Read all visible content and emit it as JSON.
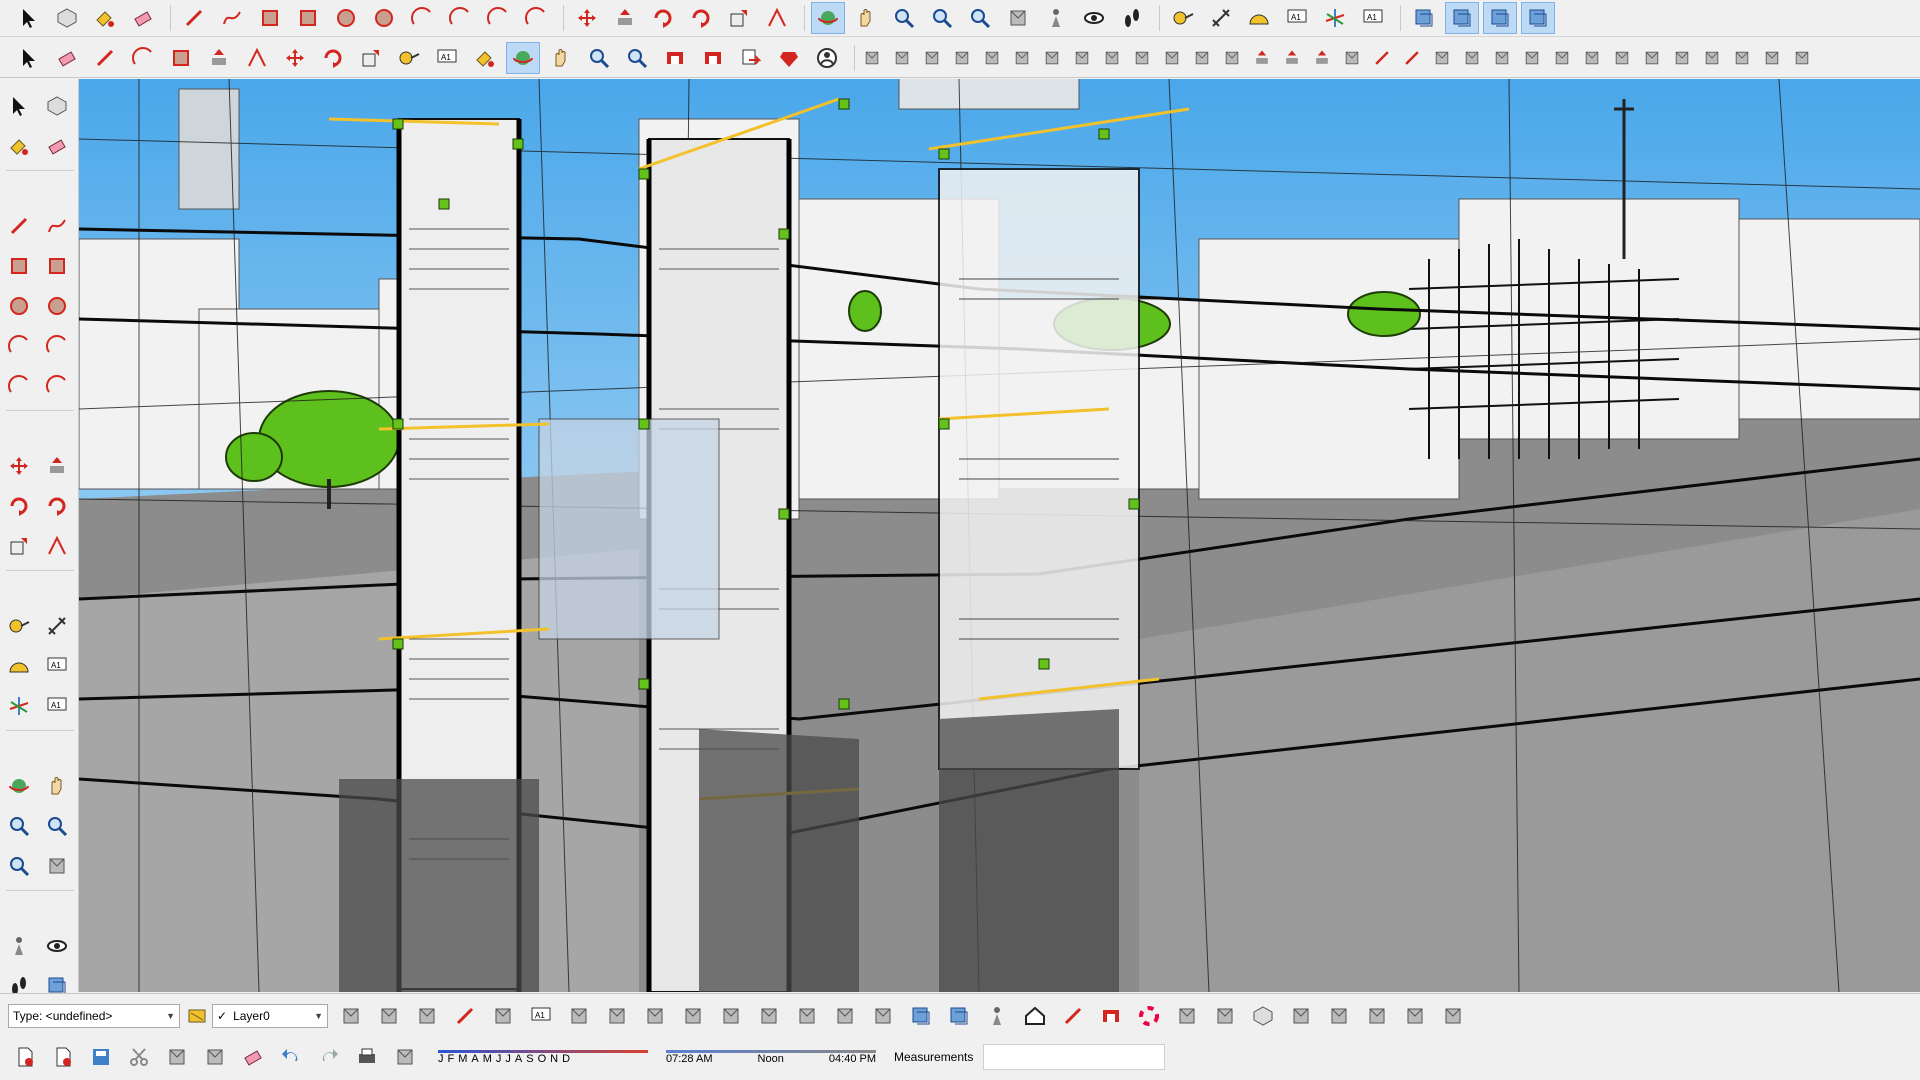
{
  "colors": {
    "red": "#d3261f",
    "sky": "#a7d4f2",
    "green": "#64c21a",
    "yellow": "#f1c22c",
    "gray": "#8e8e8e",
    "blue": "#3d7fc9"
  },
  "toolbar_top": [
    {
      "name": "select-icon"
    },
    {
      "name": "component-icon"
    },
    {
      "name": "paint-bucket-icon"
    },
    {
      "name": "eraser-icon"
    },
    {
      "sep": true
    },
    {
      "name": "line-icon"
    },
    {
      "name": "freehand-icon"
    },
    {
      "name": "rectangle-icon"
    },
    {
      "name": "rotated-rectangle-icon"
    },
    {
      "name": "circle-icon"
    },
    {
      "name": "polygon-icon"
    },
    {
      "name": "arc-icon"
    },
    {
      "name": "two-point-arc-icon"
    },
    {
      "name": "three-point-arc-icon"
    },
    {
      "name": "pie-icon"
    },
    {
      "sep": true
    },
    {
      "name": "move-icon"
    },
    {
      "name": "push-pull-icon"
    },
    {
      "name": "rotate-icon"
    },
    {
      "name": "follow-me-icon"
    },
    {
      "name": "scale-icon"
    },
    {
      "name": "offset-icon"
    },
    {
      "sep": true
    },
    {
      "name": "orbit-icon",
      "active": true
    },
    {
      "name": "pan-icon"
    },
    {
      "name": "zoom-icon"
    },
    {
      "name": "zoom-window-icon"
    },
    {
      "name": "zoom-extents-icon"
    },
    {
      "name": "previous-view-icon"
    },
    {
      "name": "position-camera-icon"
    },
    {
      "name": "look-around-icon"
    },
    {
      "name": "walk-icon"
    },
    {
      "sep": true
    },
    {
      "name": "tape-measure-icon"
    },
    {
      "name": "dimension-icon"
    },
    {
      "name": "protractor-icon"
    },
    {
      "name": "text-icon"
    },
    {
      "name": "axes-icon"
    },
    {
      "name": "3d-text-icon"
    },
    {
      "sep": true
    },
    {
      "name": "section-plane-icon"
    },
    {
      "name": "display-section-planes-icon",
      "active": true
    },
    {
      "name": "display-section-cuts-icon",
      "active": true
    },
    {
      "name": "display-section-fill-icon",
      "active": true
    }
  ],
  "toolbar_second": [
    {
      "name": "select-icon"
    },
    {
      "name": "eraser-icon"
    },
    {
      "name": "line-icon"
    },
    {
      "name": "arc-icon"
    },
    {
      "name": "rectangle-icon"
    },
    {
      "name": "push-pull-icon"
    },
    {
      "name": "offset-icon"
    },
    {
      "name": "move-icon"
    },
    {
      "name": "rotate-icon"
    },
    {
      "name": "scale-icon"
    },
    {
      "name": "tape-measure-icon"
    },
    {
      "name": "text-icon"
    },
    {
      "name": "paint-bucket-icon"
    },
    {
      "name": "orbit-icon",
      "active": true
    },
    {
      "name": "pan-icon"
    },
    {
      "name": "zoom-icon"
    },
    {
      "name": "zoom-extents-icon"
    },
    {
      "name": "3d-warehouse-icon"
    },
    {
      "name": "extension-warehouse-icon"
    },
    {
      "name": "send-to-layout-icon"
    },
    {
      "name": "ruby-icon"
    },
    {
      "name": "user-icon"
    }
  ],
  "toolbar_second_small": [
    "sandbox-from-contours-icon",
    "sandbox-from-scratch-icon",
    "smoove-icon",
    "stamp-icon",
    "drape-icon",
    "add-detail-icon",
    "flip-edge-icon",
    "round-corner-icon",
    "chamfer-icon",
    "fillet-icon",
    "extrude-icon",
    "loft-icon",
    "curviloft-icon",
    "joint-push-pull-icon",
    "vector-push-pull-icon",
    "normal-push-pull-icon",
    "bezier-icon",
    "polyline-icon",
    "spline-icon",
    "catenary-icon",
    "helix-icon",
    "spiral-icon",
    "profile-icon",
    "lathe-icon",
    "sweep-icon",
    "skin-icon",
    "shell-icon",
    "solid-union-icon",
    "solid-subtract-icon",
    "solid-trim-icon",
    "solid-split-icon",
    "solid-intersect-icon"
  ],
  "side_tools": [
    [
      "select-icon",
      "component-icon"
    ],
    [
      "paint-bucket-icon",
      "eraser-icon"
    ],
    [
      "sep"
    ],
    [
      "line-icon",
      "freehand-icon"
    ],
    [
      "rectangle-icon",
      "rotated-rectangle-icon"
    ],
    [
      "circle-icon",
      "polygon-icon"
    ],
    [
      "arc-icon",
      "two-point-arc-icon"
    ],
    [
      "three-point-arc-icon",
      "pie-icon"
    ],
    [
      "sep"
    ],
    [
      "move-icon",
      "push-pull-icon"
    ],
    [
      "rotate-icon",
      "follow-me-icon"
    ],
    [
      "scale-icon",
      "offset-icon"
    ],
    [
      "sep"
    ],
    [
      "tape-measure-icon",
      "dimension-icon"
    ],
    [
      "protractor-icon",
      "text-icon"
    ],
    [
      "axes-icon",
      "3d-text-icon"
    ],
    [
      "sep"
    ],
    [
      "orbit-icon",
      "pan-icon"
    ],
    [
      "zoom-icon",
      "zoom-window-icon"
    ],
    [
      "zoom-extents-icon",
      "previous-view-icon"
    ],
    [
      "sep"
    ],
    [
      "position-camera-icon",
      "look-around-icon"
    ],
    [
      "walk-icon",
      "section-plane-icon"
    ]
  ],
  "statusbar": {
    "type_label": "Type: <undefined>",
    "layer_label": "Layer0",
    "months": [
      "J",
      "F",
      "M",
      "A",
      "M",
      "J",
      "J",
      "A",
      "S",
      "O",
      "N",
      "D"
    ],
    "time_start": "07:28 AM",
    "time_mid": "Noon",
    "time_end": "04:40 PM",
    "measurements_label": "Measurements",
    "row1_icons": [
      "xray-icon",
      "back-edges-icon",
      "wireframe-icon",
      "hidden-line-icon",
      "shaded-icon",
      "shaded-with-textures-icon",
      "monochrome-icon",
      "shadow-icon",
      "fog-icon",
      "iso-view-icon",
      "top-view-icon",
      "front-view-icon",
      "right-view-icon",
      "back-view-icon",
      "left-view-icon",
      "section-display-icon",
      "section-cut-icon",
      "camera-icon",
      "house-icon",
      "house-outline-icon",
      "warehouse-icon",
      "color-wheel-icon",
      "flip-icon",
      "layer-manager-icon",
      "component-manager-icon",
      "materials-icon",
      "styles-icon",
      "scenes-icon",
      "sandbox-icon",
      "shadow-settings-icon"
    ],
    "row2_icons": [
      "new-file-icon",
      "open-file-icon",
      "save-icon",
      "cut-icon",
      "copy-icon",
      "paste-icon",
      "erase-icon",
      "undo-icon",
      "redo-icon",
      "print-icon",
      "model-info-icon"
    ]
  }
}
